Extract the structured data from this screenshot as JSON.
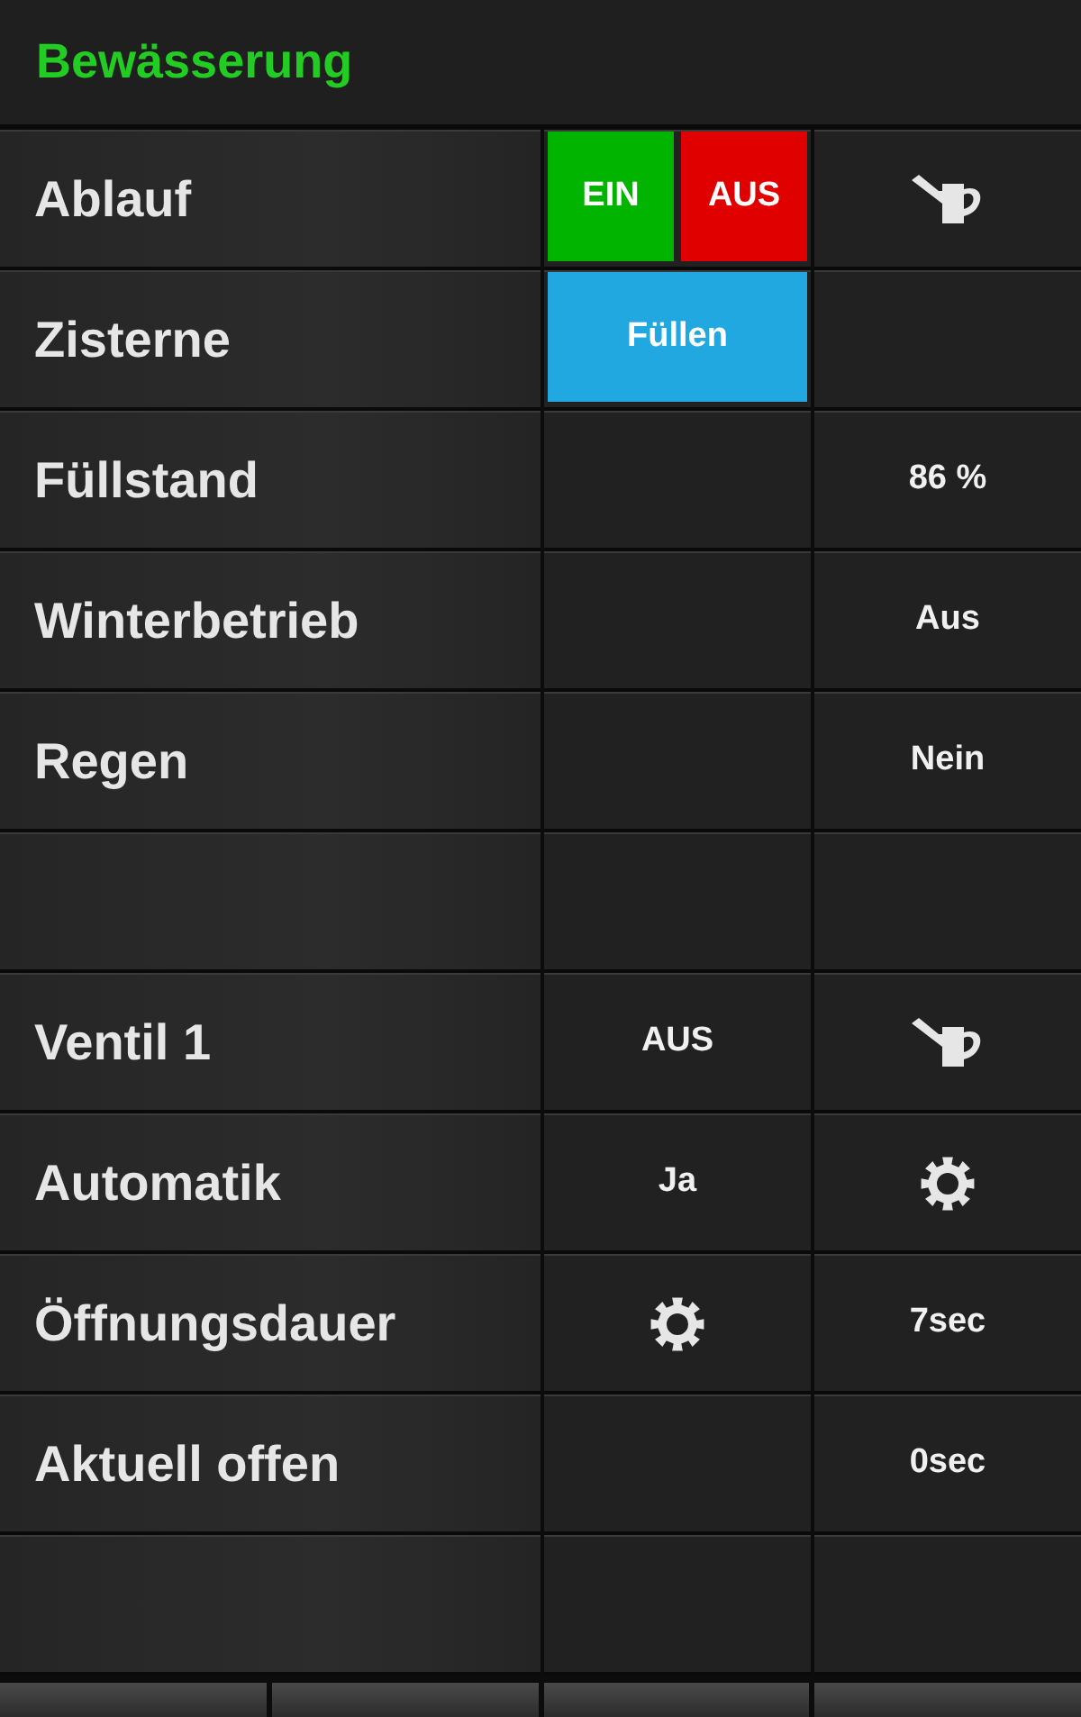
{
  "title": "Bewässerung",
  "rows": [
    {
      "label": "Ablauf",
      "cells": [
        {
          "kind": "buttons",
          "buttons": [
            {
              "label": "EIN",
              "color": "#00b400"
            },
            {
              "label": "AUS",
              "color": "#e00000"
            }
          ]
        },
        {
          "kind": "can"
        }
      ]
    },
    {
      "label": "Zisterne",
      "cells": [
        {
          "kind": "buttons",
          "buttons": [
            {
              "label": "Füllen",
              "color": "#22a8e0"
            }
          ]
        },
        {
          "kind": "empty"
        }
      ]
    },
    {
      "label": "Füllstand",
      "cells": [
        {
          "kind": "empty"
        },
        {
          "kind": "text",
          "text": "86 %"
        }
      ]
    },
    {
      "label": "Winterbetrieb",
      "cells": [
        {
          "kind": "empty"
        },
        {
          "kind": "text",
          "text": "Aus"
        }
      ]
    },
    {
      "label": "Regen",
      "cells": [
        {
          "kind": "empty"
        },
        {
          "kind": "text",
          "text": "Nein"
        }
      ]
    },
    {
      "cells": [
        {
          "kind": "empty"
        },
        {
          "kind": "empty"
        }
      ]
    },
    {
      "label": "Ventil 1",
      "cells": [
        {
          "kind": "text",
          "text": "AUS"
        },
        {
          "kind": "can"
        }
      ]
    },
    {
      "label": "Automatik",
      "cells": [
        {
          "kind": "text",
          "text": "Ja"
        },
        {
          "kind": "gear"
        }
      ]
    },
    {
      "label": "Öffnungsdauer",
      "cells": [
        {
          "kind": "gear"
        },
        {
          "kind": "text",
          "text": "7sec"
        }
      ]
    },
    {
      "label": "Aktuell offen",
      "cells": [
        {
          "kind": "empty"
        },
        {
          "kind": "text",
          "text": "0sec"
        }
      ]
    },
    {
      "cells": [
        {
          "kind": "empty"
        },
        {
          "kind": "empty"
        }
      ]
    }
  ]
}
